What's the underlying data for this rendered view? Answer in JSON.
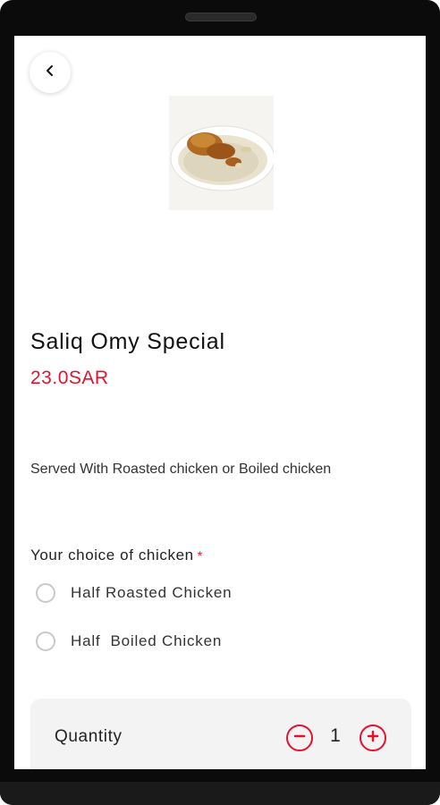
{
  "item": {
    "title": "Saliq Omy Special",
    "price": "23.0SAR",
    "description": "Served With Roasted chicken or Boiled chicken"
  },
  "options_group": {
    "label": "Your choice of chicken",
    "required_mark": "*",
    "options": [
      {
        "label": "Half Roasted Chicken",
        "selected": false
      },
      {
        "label": "Half  Boiled Chicken",
        "selected": false
      }
    ]
  },
  "quantity": {
    "label": "Quantity",
    "value": "1"
  },
  "colors": {
    "accent": "#e3122d",
    "panel": "#f3f3f3",
    "device_frame": "#0b0b0b"
  },
  "icons": {
    "back": "chevron-left-icon",
    "decrement": "minus-circle-icon",
    "increment": "plus-circle-icon"
  }
}
